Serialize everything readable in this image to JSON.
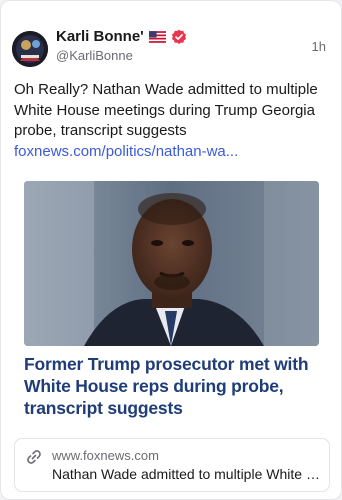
{
  "post": {
    "author_name": "Karli Bonne'",
    "handle": "@KarliBonne",
    "timestamp": "1h",
    "text": "Oh Really? Nathan Wade admitted to multiple White House meetings during Trump Georgia probe, transcript suggests ",
    "link_text": "foxnews.com/politics/nathan-wa..."
  },
  "article": {
    "headline": "Former Trump prosecutor met with White House reps during probe, transcript suggests"
  },
  "link_card": {
    "domain": "www.foxnews.com",
    "title": "Nathan Wade admitted to multiple White House meetings during Trump Georgia probe, transcript suggests"
  },
  "icons": {
    "flag": "us-flag-icon",
    "verified": "verified-badge-icon",
    "link": "link-icon"
  },
  "colors": {
    "link": "#3b5bdb",
    "headline": "#1f3d78",
    "verified": "#e8364f"
  }
}
